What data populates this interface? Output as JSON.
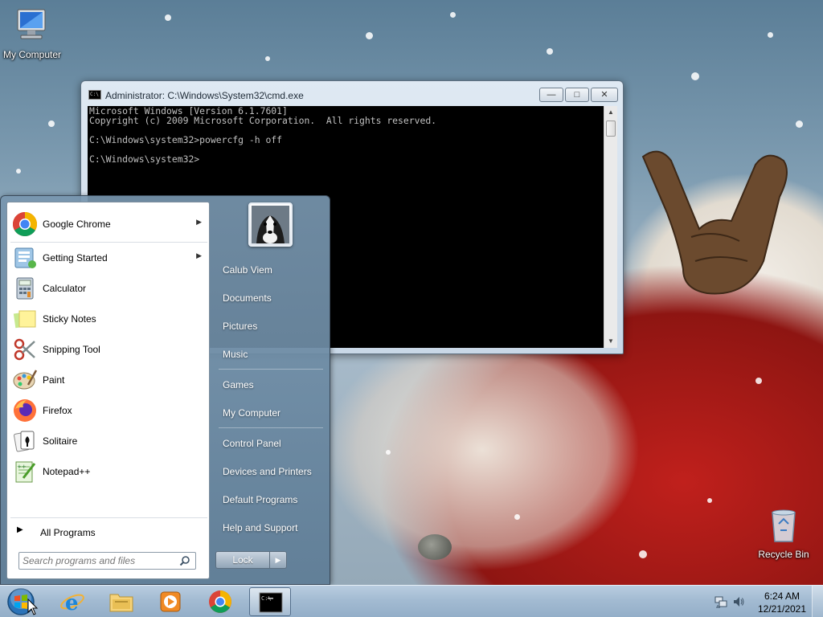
{
  "desktop": {
    "icons": [
      {
        "label": "My Computer",
        "icon": "computer-icon"
      },
      {
        "label": "Recycle Bin",
        "icon": "recycle-bin-icon"
      }
    ]
  },
  "cmd_window": {
    "title": "Administrator: C:\\Windows\\System32\\cmd.exe",
    "lines": [
      "Microsoft Windows [Version 6.1.7601]",
      "Copyright (c) 2009 Microsoft Corporation.  All rights reserved.",
      "",
      "C:\\Windows\\system32>powercfg -h off",
      "",
      "C:\\Windows\\system32>"
    ],
    "title_icon_text": "C:\\",
    "min_glyph": "—",
    "max_glyph": "□",
    "close_glyph": "✕"
  },
  "start_menu": {
    "programs": [
      {
        "label": "Google Chrome",
        "icon": "chrome-icon",
        "has_submenu": true
      },
      {
        "label": "Getting Started",
        "icon": "getting-started-icon",
        "has_submenu": true
      },
      {
        "label": "Calculator",
        "icon": "calculator-icon",
        "has_submenu": false
      },
      {
        "label": "Sticky Notes",
        "icon": "sticky-notes-icon",
        "has_submenu": false
      },
      {
        "label": "Snipping Tool",
        "icon": "scissors-icon",
        "has_submenu": false
      },
      {
        "label": "Paint",
        "icon": "paint-palette-icon",
        "has_submenu": false
      },
      {
        "label": "Firefox",
        "icon": "firefox-icon",
        "has_submenu": false
      },
      {
        "label": "Solitaire",
        "icon": "solitaire-icon",
        "has_submenu": false
      },
      {
        "label": "Notepad++",
        "icon": "notepad-plus-plus-icon",
        "has_submenu": false
      }
    ],
    "submenu_arrow": "▶",
    "all_programs": "All Programs",
    "all_programs_arrow": "▶",
    "search_placeholder": "Search programs and files",
    "right_links": {
      "user": "Calub Viem",
      "documents": "Documents",
      "pictures": "Pictures",
      "music": "Music",
      "games": "Games",
      "computer": "My Computer",
      "control_panel": "Control Panel",
      "devices": "Devices and Printers",
      "default_programs": "Default Programs",
      "help": "Help and Support"
    },
    "lock_label": "Lock",
    "lock_more_glyph": "▶"
  },
  "taskbar": {
    "items": [
      {
        "name": "internet-explorer",
        "icon": "internet-explorer-icon",
        "active": false
      },
      {
        "name": "file-explorer",
        "icon": "folder-icon",
        "active": false
      },
      {
        "name": "media-player",
        "icon": "media-player-icon",
        "active": false
      },
      {
        "name": "chrome",
        "icon": "chrome-icon",
        "active": false
      },
      {
        "name": "cmd",
        "icon": "command-prompt-icon",
        "active": true
      }
    ],
    "cmd_icon_text": "C:\\",
    "clock_time": "6:24 AM",
    "clock_date": "12/21/2021"
  },
  "colors": {
    "console_bg": "#000000",
    "console_fg": "#c0c0c0",
    "accent": "#1e90ff"
  }
}
